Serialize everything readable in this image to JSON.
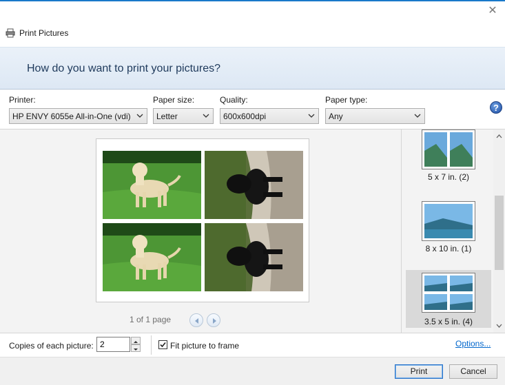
{
  "window": {
    "title": "Print Pictures",
    "close_glyph": "✕"
  },
  "banner": {
    "question": "How do you want to print your pictures?"
  },
  "settings": {
    "printer": {
      "label": "Printer:",
      "value": "HP ENVY 6055e All-in-One (vdi)"
    },
    "paper_size": {
      "label": "Paper size:",
      "value": "Letter"
    },
    "quality": {
      "label": "Quality:",
      "value": "600x600dpi"
    },
    "paper_type": {
      "label": "Paper type:",
      "value": "Any"
    },
    "help_glyph": "?"
  },
  "preview": {
    "photos": [
      {
        "subject": "yellow-labrador-on-grass"
      },
      {
        "subject": "black-puppy-rotated"
      },
      {
        "subject": "yellow-labrador-on-grass"
      },
      {
        "subject": "black-puppy-rotated"
      }
    ],
    "page_indicator": "1 of 1 page"
  },
  "layouts": {
    "items": [
      {
        "label": "5 x 7 in. (2)",
        "selected": false
      },
      {
        "label": "8 x 10 in. (1)",
        "selected": false
      },
      {
        "label": "3.5 x 5 in. (4)",
        "selected": true
      }
    ],
    "scroll_position": 0.35
  },
  "bottom": {
    "copies_label": "Copies of each picture:",
    "copies_value": "2",
    "fit_label": "Fit picture to frame",
    "fit_checked": true,
    "options_link": "Options..."
  },
  "buttons": {
    "print": "Print",
    "cancel": "Cancel"
  }
}
